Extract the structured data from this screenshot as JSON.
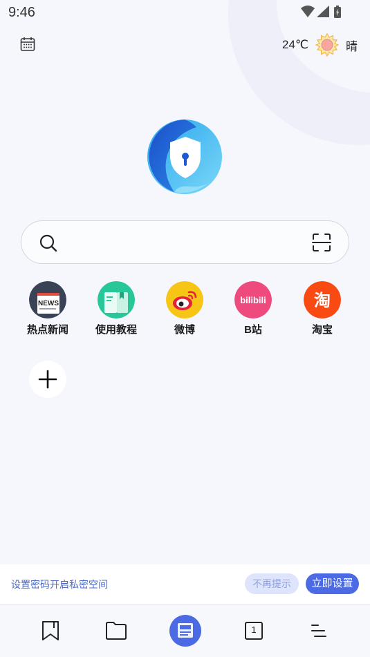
{
  "status_bar": {
    "time": "9:46",
    "icons": [
      "wifi-icon",
      "cell-signal-icon",
      "battery-icon"
    ]
  },
  "header": {
    "calendar_icon": "calendar-icon",
    "weather": {
      "temperature": "24℃",
      "condition": "晴",
      "icon": "sun-icon"
    }
  },
  "logo": {
    "icon": "shield-lock-logo",
    "colors": [
      "#1c5fd6",
      "#35b7ef"
    ]
  },
  "search": {
    "search_icon": "search-icon",
    "scan_icon": "scan-icon"
  },
  "shortcuts": [
    {
      "label": "热点新闻",
      "icon": "news-icon",
      "badge": "NEWS",
      "color": "#3a4256"
    },
    {
      "label": "使用教程",
      "icon": "tutorial-book-icon",
      "color": "#27c79a"
    },
    {
      "label": "微博",
      "icon": "weibo-icon",
      "color": "#f7c515"
    },
    {
      "label": "B站",
      "icon": "bilibili-icon",
      "badge": "bilibili",
      "color": "#ee4a7e"
    },
    {
      "label": "淘宝",
      "icon": "taobao-icon",
      "badge": "淘",
      "color": "#fa4a14"
    }
  ],
  "add_shortcut_icon": "plus-icon",
  "banner": {
    "text": "设置密码开启私密空间",
    "dismiss_label": "不再提示",
    "setup_label": "立即设置",
    "accent": "#4b6ae3"
  },
  "bottom_nav": {
    "items": [
      {
        "name": "bookmark",
        "icon": "bookmark-icon"
      },
      {
        "name": "files",
        "icon": "folder-icon"
      },
      {
        "name": "news",
        "icon": "newspaper-icon",
        "active": true
      },
      {
        "name": "tabs",
        "icon": "tabs-icon",
        "count": "1"
      },
      {
        "name": "menu",
        "icon": "menu-icon"
      }
    ]
  }
}
